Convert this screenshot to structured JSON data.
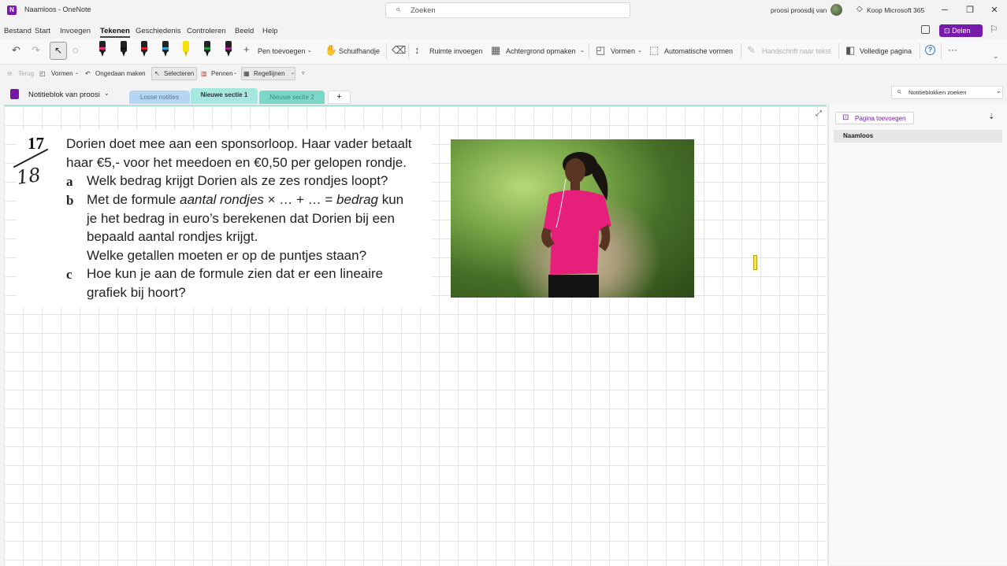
{
  "titlebar": {
    "app_icon": "N",
    "title": "Naamloos - OneNote",
    "search_placeholder": "Zoeken",
    "user_name": "proosi proosdij van",
    "buy_label": "Koop Microsoft 365",
    "minimize": "─",
    "restore": "❐",
    "close": "✕"
  },
  "menu": {
    "items": [
      "Bestand",
      "Start",
      "Invoegen",
      "Tekenen",
      "Geschiedenis",
      "Controleren",
      "Beeld",
      "Help"
    ],
    "active": "Tekenen",
    "share_label": "Delen"
  },
  "ribbon": {
    "pen_colors": [
      "#e0307a",
      "#111111",
      "#d61f2c",
      "#2aa3d8",
      "#f5e10a",
      "#1d9a42",
      "#a0208c"
    ],
    "add_pen": "Pen toevoegen",
    "hand_tool": "Schuifhandje",
    "insert_space": "Ruimte invoegen",
    "background": "Achtergrond opmaken",
    "shapes": "Vormen",
    "auto_shapes": "Automatische vormen",
    "ink_to_text": "Handschrift naar tekst",
    "full_page": "Volledige pagina",
    "more": "···"
  },
  "quickbar": {
    "back": "Terug",
    "shapes": "Vormen",
    "undo": "Ongedaan maken",
    "select": "Selecteren",
    "pens": "Pennen",
    "rule_lines": "Regellijnen"
  },
  "notebook": {
    "name": "Notitieblok van proosi",
    "tabs": [
      {
        "label": "Losse notities",
        "color": "#b4d6f2",
        "text_color": "#4a77a8"
      },
      {
        "label": "Nieuwe sectie 1",
        "color": "#a6e8df",
        "text_color": "#333333"
      },
      {
        "label": "Nieuwe sectie 2",
        "color": "#7cd9c9",
        "text_color": "#3a8a7c"
      }
    ],
    "add_tab": "+",
    "search_placeholder": "Notitieblokken zoeken"
  },
  "exercise": {
    "number": "17",
    "handwritten_number": "18",
    "lines": [
      "Dorien doet mee aan een sponsorloop. Haar vader betaalt",
      "haar €5,- voor het meedoen en €0,50 per gelopen rondje."
    ],
    "a_letter": "a",
    "a_text": "Welk bedrag krijgt Dorien als ze zes rondjes loopt?",
    "b_letter": "b",
    "b_line1_pre": "Met de formule ",
    "b_line1_it1": "aantal rondjes",
    "b_line1_mid": " × … + … = ",
    "b_line1_it2": "bedrag",
    "b_line1_post": " kun",
    "b_line2": "je het bedrag in euro’s berekenen dat Dorien bij een",
    "b_line3": "bepaald aantal rondjes krijgt.",
    "b_line4": "Welke getallen moeten er op de puntjes staan?",
    "c_letter": "c",
    "c_line1": "Hoe kun je aan de formule zien dat er een lineaire",
    "c_line2": "grafiek bij hoort?"
  },
  "pages": {
    "add_page": "Pagina toevoegen",
    "items": [
      "Naamloos"
    ]
  }
}
